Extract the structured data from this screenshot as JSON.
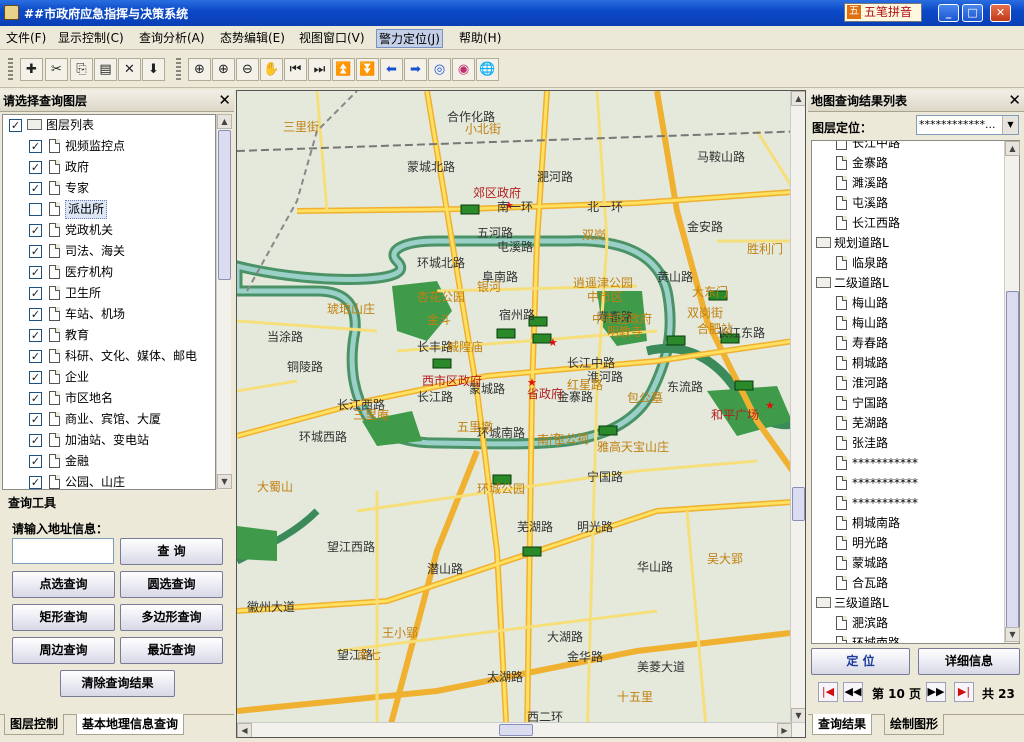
{
  "window": {
    "title": "##市政府应急指挥与决策系统",
    "ime": "五笔拼音",
    "min": "_",
    "max": "□",
    "close": "✕"
  },
  "menu": [
    "文件(F)",
    "显示控制(C)",
    "查询分析(A)",
    "态势编辑(E)",
    "视图窗口(V)",
    "警力定位(J)",
    "帮助(H)"
  ],
  "toolbar": {
    "edit_icons": [
      "add-layer",
      "cut",
      "copy",
      "paste",
      "delete",
      "import"
    ],
    "edit_glyphs": [
      "✚",
      "✂",
      "⎘",
      "▤",
      "✕",
      "⬇"
    ],
    "view_icons": [
      "zoom-region",
      "zoom-in",
      "zoom-out",
      "pan",
      "prev-extent",
      "next-extent",
      "up",
      "down",
      "back",
      "forward",
      "locate",
      "measure",
      "globe"
    ],
    "view_glyphs": [
      "⊕",
      "⊕",
      "⊖",
      "✋",
      "⏮",
      "⏭",
      "⏫",
      "⏬",
      "⬅",
      "➡",
      "◎",
      "◉",
      "🌐"
    ]
  },
  "left_panel": {
    "title": "请选择查询图层",
    "close": "✕",
    "tree_root": "图层列表",
    "layers": [
      {
        "label": "视频监控点",
        "checked": true
      },
      {
        "label": "政府",
        "checked": true
      },
      {
        "label": "专家",
        "checked": true
      },
      {
        "label": "派出所",
        "checked": false
      },
      {
        "label": "党政机关",
        "checked": true
      },
      {
        "label": "司法、海关",
        "checked": true
      },
      {
        "label": "医疗机构",
        "checked": true
      },
      {
        "label": "卫生所",
        "checked": true
      },
      {
        "label": "车站、机场",
        "checked": true
      },
      {
        "label": "教育",
        "checked": true
      },
      {
        "label": "科研、文化、媒体、邮电",
        "checked": true
      },
      {
        "label": "企业",
        "checked": true
      },
      {
        "label": "市区地名",
        "checked": true
      },
      {
        "label": "商业、宾馆、大厦",
        "checked": true
      },
      {
        "label": "加油站、变电站",
        "checked": true
      },
      {
        "label": "金融",
        "checked": true
      },
      {
        "label": "公园、山庄",
        "checked": true
      }
    ],
    "query_tools_title": "查询工具",
    "address_label": "请输入地址信息：",
    "address_value": "",
    "buttons": {
      "query": "查 询",
      "point": "点选查询",
      "circle": "圆选查询",
      "rect": "矩形查询",
      "polygon": "多边形查询",
      "around": "周边查询",
      "nearest": "最近查询",
      "clear": "清除查询结果"
    },
    "tabs": [
      "图层控制",
      "基本地理信息查询"
    ]
  },
  "map": {
    "roads": [
      "长江中路",
      "长江西路",
      "长江东路",
      "长江路",
      "环城北路",
      "环城西路",
      "环城南路",
      "五河路",
      "寿春路",
      "淮河路",
      "阜南路",
      "宿州路",
      "蒙城路",
      "金寨路",
      "黄山路",
      "望江西路",
      "望江路",
      "太湖路",
      "大湖路",
      "徽州大道",
      "马鞍山路",
      "北一环",
      "屯溪路",
      "芜湖路",
      "明光路",
      "金安路",
      "宁国路",
      "合作化路",
      "东流路",
      "金华路",
      "华山路",
      "潜山路",
      "长丰路",
      "淝河路",
      "美菱大道",
      "南一环",
      "蒙城北路",
      "当涂路",
      "铜陵路",
      "西二环"
    ],
    "places": [
      "郊区政府",
      "西市区政府",
      "省政府",
      "和平广场",
      "城隍庙",
      "杏花公园",
      "琥珀山庄",
      "逍遥津公园",
      "明教寺",
      "包公祠",
      "包公墓",
      "雅高天宝山庄",
      "环城公园",
      "银河",
      "大蜀山",
      "三里街",
      "双岗",
      "合肥站",
      "中市区",
      "中市区政府",
      "金斗",
      "大东门",
      "南七",
      "王小郢",
      "十五里",
      "三里庵",
      "五里墩",
      "南门",
      "红星路",
      "吴大郢",
      "小北街",
      "胜利门",
      "双岗街"
    ]
  },
  "right_panel": {
    "title": "地图查询结果列表",
    "close": "✕",
    "locate_label": "图层定位：",
    "locate_value": "************...",
    "results": [
      {
        "label": "长江中路",
        "type": "leaf"
      },
      {
        "label": "金寨路",
        "type": "leaf"
      },
      {
        "label": "濉溪路",
        "type": "leaf"
      },
      {
        "label": "屯溪路",
        "type": "leaf"
      },
      {
        "label": "长江西路",
        "type": "leaf"
      },
      {
        "label": "规划道路L",
        "type": "folder"
      },
      {
        "label": "临泉路",
        "type": "leaf"
      },
      {
        "label": "二级道路L",
        "type": "folder"
      },
      {
        "label": "梅山路",
        "type": "leaf"
      },
      {
        "label": "梅山路",
        "type": "leaf"
      },
      {
        "label": "寿春路",
        "type": "leaf"
      },
      {
        "label": "桐城路",
        "type": "leaf"
      },
      {
        "label": "淮河路",
        "type": "leaf"
      },
      {
        "label": "宁国路",
        "type": "leaf"
      },
      {
        "label": "芜湖路",
        "type": "leaf"
      },
      {
        "label": "张洼路",
        "type": "leaf"
      },
      {
        "label": "***********",
        "type": "leaf"
      },
      {
        "label": "***********",
        "type": "leaf"
      },
      {
        "label": "***********",
        "type": "leaf"
      },
      {
        "label": "桐城南路",
        "type": "leaf"
      },
      {
        "label": "明光路",
        "type": "leaf"
      },
      {
        "label": "蒙城路",
        "type": "leaf"
      },
      {
        "label": "合瓦路",
        "type": "leaf"
      },
      {
        "label": "三级道路L",
        "type": "folder"
      },
      {
        "label": "淝滨路",
        "type": "leaf"
      },
      {
        "label": "环城南路",
        "type": "leaf"
      }
    ],
    "locate_btn": "定 位",
    "detail_btn": "详细信息",
    "page_label": "第 10 页",
    "total_label": "共 23",
    "tabs": [
      "查询结果",
      "绘制图形"
    ]
  }
}
